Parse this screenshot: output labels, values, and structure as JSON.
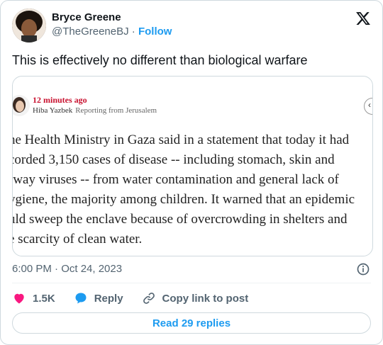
{
  "author": {
    "name": "Bryce Greene",
    "handle": "@TheGreeneBJ",
    "separator": "·",
    "follow_label": "Follow"
  },
  "tweet_text": "This is effectively no different than biological warfare",
  "embed": {
    "timeago": "12 minutes ago",
    "reporter": "Hiba Yazbek",
    "reporter_role": "Reporting from Jerusalem",
    "nav_icon": "chevron-left-icon",
    "article_lines": [
      "he Health Ministry in Gaza said in a statement that today it had",
      "corded 3,150 cases of disease -- including stomach, skin and",
      "rway viruses -- from water contamination and general lack of",
      "ygiene, the majority among children. It warned that an epidemic",
      "uld sweep the enclave because of overcrowding in shelters and",
      "e scarcity of clean water."
    ]
  },
  "timestamp": "6:00 PM · Oct 24, 2023",
  "actions": {
    "likes_count": "1.5K",
    "reply_label": "Reply",
    "copy_label": "Copy link to post"
  },
  "read_replies_label": "Read 29 replies",
  "colors": {
    "accent": "#1d9bf0",
    "like": "#f91880",
    "muted": "#536471",
    "border": "#cfd9de",
    "embed_time": "#c8102e"
  }
}
